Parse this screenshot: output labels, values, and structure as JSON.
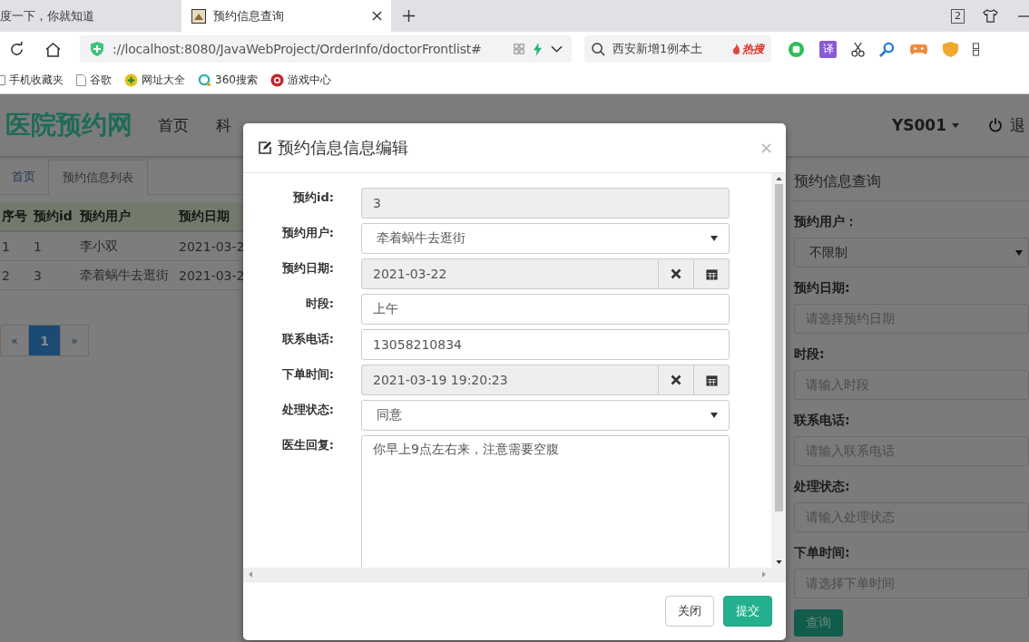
{
  "browser": {
    "tabs": [
      {
        "title": "度一下，你就知道",
        "selected": false
      },
      {
        "title": "预约信息查询",
        "selected": true
      }
    ],
    "tab_count": "2",
    "url": "://localhost:8080/JavaWebProject/OrderInfo/doctorFrontlist#",
    "search": {
      "query": "西安新增1例本土",
      "hot": "热搜"
    },
    "extension_label": "译",
    "bookmarks": [
      {
        "label": "手机收藏夹",
        "kind": "phone"
      },
      {
        "label": "谷歌",
        "kind": "page"
      },
      {
        "label": "网址大全",
        "kind": "plus"
      },
      {
        "label": "360搜索",
        "kind": "ring"
      },
      {
        "label": "游戏中心",
        "kind": "game"
      }
    ]
  },
  "site": {
    "logo": "医院预约网",
    "nav": [
      {
        "label": "首页"
      },
      {
        "label": "科"
      }
    ],
    "user": "YS001",
    "logout": "退"
  },
  "tabs": [
    {
      "label": "首页",
      "selected": false
    },
    {
      "label": "预约信息列表",
      "selected": true
    }
  ],
  "table": {
    "columns": [
      "序号",
      "预约id",
      "预约用户",
      "预约日期"
    ],
    "rows": [
      [
        "1",
        "1",
        "李小双",
        "2021-03-2"
      ],
      [
        "2",
        "3",
        "牵着蜗牛去逛街",
        "2021-03-2"
      ]
    ]
  },
  "pagination": [
    {
      "label": "«",
      "selected": false
    },
    {
      "label": "1",
      "selected": true
    },
    {
      "label": "»",
      "selected": false
    }
  ],
  "search_panel": {
    "title": "预约信息查询",
    "fields": [
      {
        "label": "预约用户：",
        "kind": "select",
        "value": "不限制"
      },
      {
        "label": "预约日期:",
        "kind": "input",
        "placeholder": "请选择预约日期"
      },
      {
        "label": "时段:",
        "kind": "input",
        "placeholder": "请输入时段"
      },
      {
        "label": "联系电话:",
        "kind": "input",
        "placeholder": "请输入联系电话"
      },
      {
        "label": "处理状态:",
        "kind": "input",
        "placeholder": "请输入处理状态"
      },
      {
        "label": "下单时间:",
        "kind": "input",
        "placeholder": "请选择下单时间"
      }
    ],
    "button": "查询"
  },
  "modal": {
    "title": "预约信息信息编辑",
    "fields": [
      {
        "label": "预约id:",
        "kind": "text",
        "value": "3",
        "readonly": true
      },
      {
        "label": "预约用户:",
        "kind": "select",
        "value": "牵着蜗牛去逛街",
        "readonly": false
      },
      {
        "label": "预约日期:",
        "kind": "date",
        "value": "2021-03-22",
        "readonly": true
      },
      {
        "label": "时段:",
        "kind": "text",
        "value": "上午",
        "readonly": false
      },
      {
        "label": "联系电话:",
        "kind": "text",
        "value": "13058210834",
        "readonly": false
      },
      {
        "label": "下单时间:",
        "kind": "date",
        "value": "2021-03-19 19:20:23",
        "readonly": true
      },
      {
        "label": "处理状态:",
        "kind": "select",
        "value": "同意",
        "readonly": false
      },
      {
        "label": "医生回复:",
        "kind": "textarea",
        "value": "你早上9点左右来，注意需要空腹",
        "readonly": false
      }
    ],
    "buttons": [
      {
        "label": "关闭",
        "kind": "default"
      },
      {
        "label": "提交",
        "kind": "primary"
      }
    ]
  }
}
